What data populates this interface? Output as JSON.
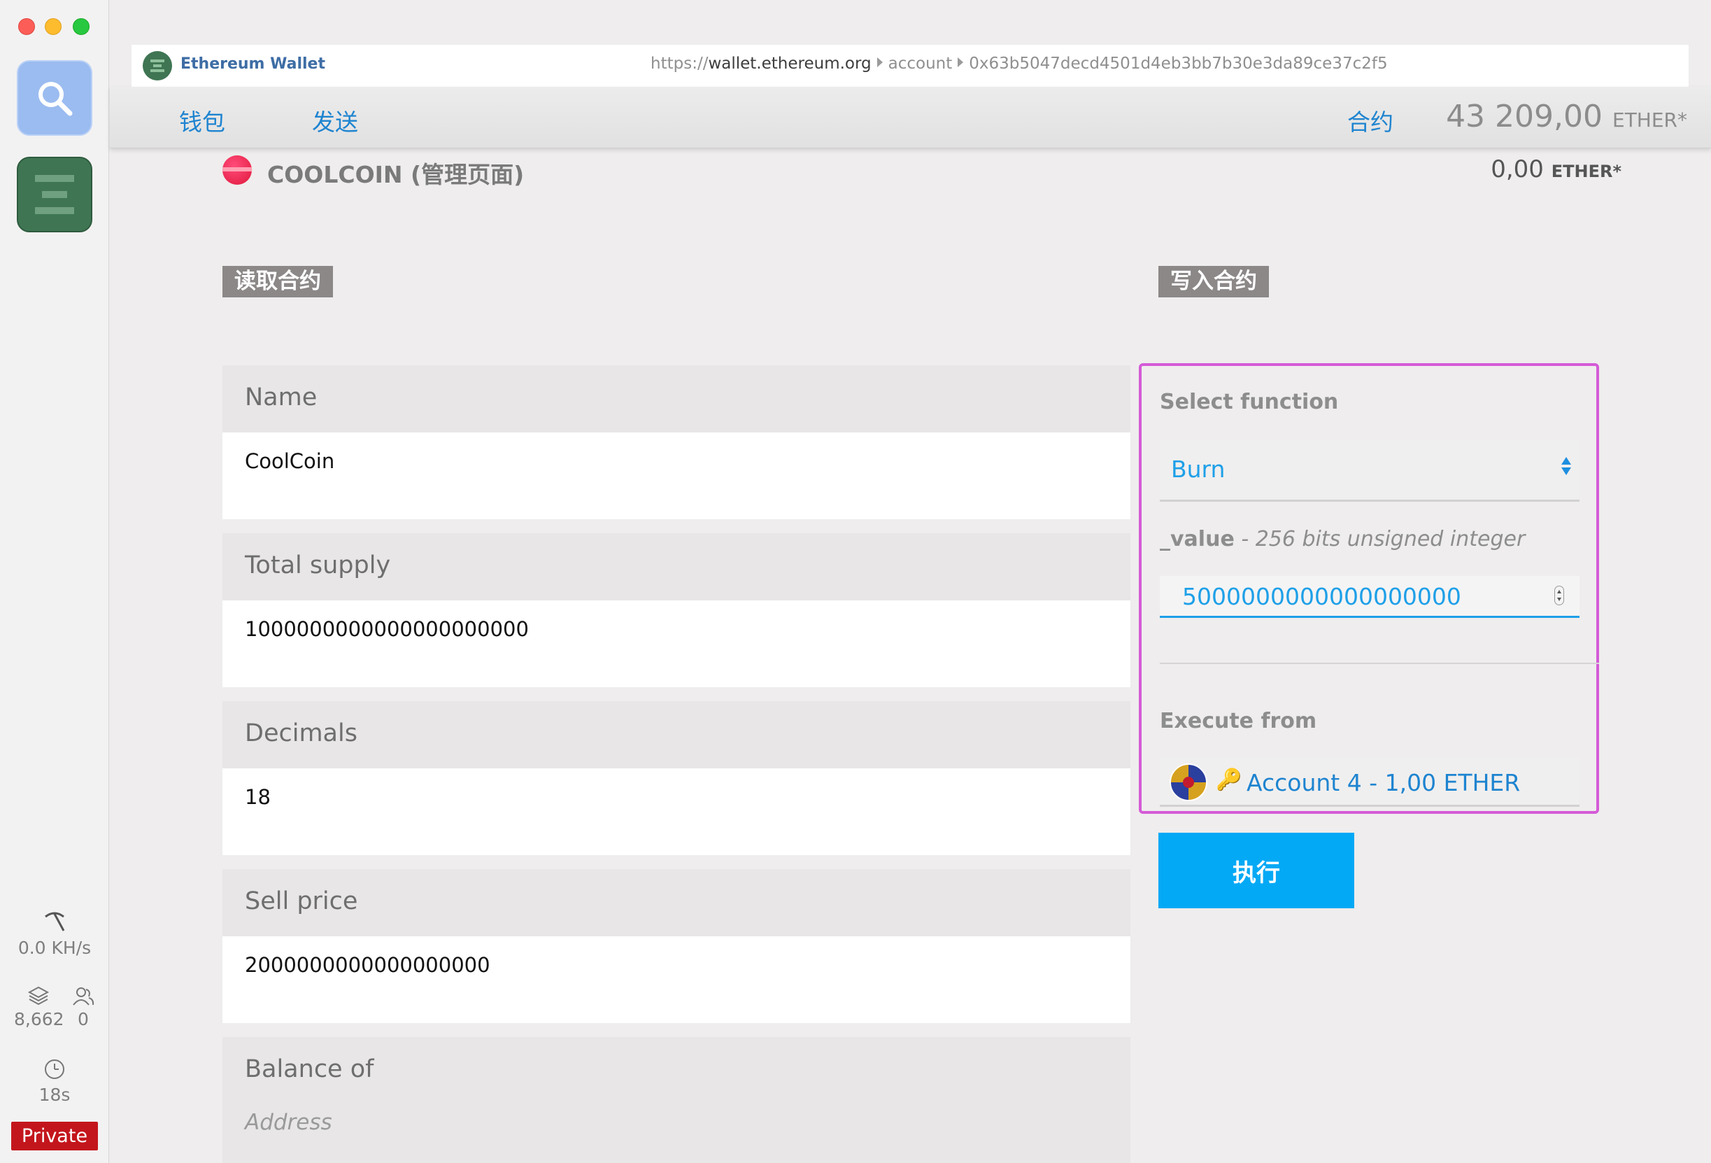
{
  "window": {
    "app_name": "Ethereum Wallet",
    "url_scheme": "https://",
    "url_host": "wallet.ethereum.org",
    "url_path": [
      "account",
      "0x63b5047decd4501d4eb3bb7b30e3da89ce37c2f5"
    ]
  },
  "sidebar": {
    "apps": [
      {
        "name": "search",
        "icon": "search-icon"
      },
      {
        "name": "wallet",
        "icon": "ethereum-wallet-icon"
      }
    ],
    "hashrate": "0.0 KH/s",
    "block_number": "8,662",
    "peers": "0",
    "block_time": "18s",
    "network_badge": "Private"
  },
  "nav": {
    "wallets": "钱包",
    "send": "发送",
    "contracts": "合约",
    "balance_amount": "43 209,00",
    "balance_unit": "ETHER*"
  },
  "token": {
    "title": "COOLCOIN (管理页面)",
    "balance_amount": "0,00",
    "balance_unit": "ETHER*"
  },
  "read_section": {
    "tag": "读取合约",
    "fields": [
      {
        "label": "Name",
        "value": "CoolCoin"
      },
      {
        "label": "Total supply",
        "value": "1000000000000000000000"
      },
      {
        "label": "Decimals",
        "value": "18"
      },
      {
        "label": "Sell price",
        "value": "2000000000000000000"
      },
      {
        "label": "Balance of",
        "placeholder": "Address"
      }
    ]
  },
  "write_section": {
    "tag": "写入合约",
    "select_function_label": "Select function",
    "selected_function": "Burn",
    "param_name": "_value",
    "param_type": " - 256 bits unsigned integer",
    "param_value": "5000000000000000000",
    "execute_from_label": "Execute from",
    "execute_from_account": "Account 4 - 1,00 ETHER",
    "execute_button": "执行"
  },
  "colors": {
    "accent_blue": "#1ea0e8",
    "link_blue": "#1e84d0",
    "highlight_border": "#d45bd7",
    "execute_button": "#04a9f5",
    "private_badge": "#c3161c",
    "section_tag": "#8c8888"
  }
}
